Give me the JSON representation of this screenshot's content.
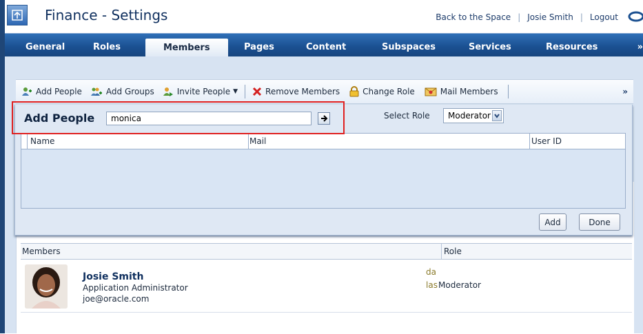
{
  "header": {
    "title": "Finance - Settings",
    "links": [
      "Back to the Space",
      "Josie Smith",
      "Logout"
    ]
  },
  "tabs": [
    {
      "label": "General"
    },
    {
      "label": "Roles"
    },
    {
      "label": "Members"
    },
    {
      "label": "Pages"
    },
    {
      "label": "Content"
    },
    {
      "label": "Subspaces"
    },
    {
      "label": "Services"
    },
    {
      "label": "Resources"
    }
  ],
  "tabs_more": "»",
  "toolbar": {
    "add_people": "Add People",
    "add_groups": "Add Groups",
    "invite_people": "Invite People",
    "remove_members": "Remove Members",
    "change_role": "Change Role",
    "mail_members": "Mail Members",
    "more": "»"
  },
  "add_panel": {
    "title": "Add People",
    "search_value": "monica",
    "columns": [
      "Name",
      "Mail",
      "User ID"
    ],
    "select_role_label": "Select Role",
    "selected_role": "Moderator",
    "add_label": "Add",
    "done_label": "Done"
  },
  "members": {
    "columns": [
      "Members",
      "Role"
    ],
    "rows": [
      {
        "name": "Josie Smith",
        "title": "Application Administrator",
        "email": "joe@oracle.com",
        "date": "date",
        "last": "las",
        "role": "Moderator"
      }
    ]
  },
  "colors": {
    "tab_bar": "#1a4f90",
    "highlight": "#e02020",
    "content_bg": "#d7e3f2"
  }
}
